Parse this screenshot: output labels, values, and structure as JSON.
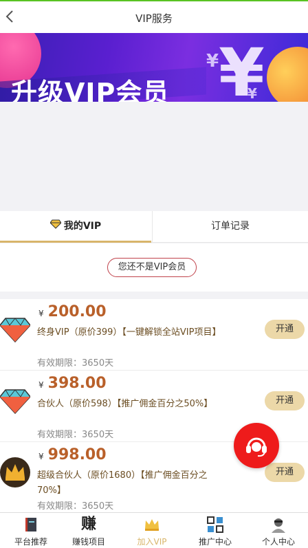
{
  "header": {
    "title": "VIP服务"
  },
  "banner": {
    "text": "升级VIP会员"
  },
  "tabs": [
    {
      "label": "我的VIP",
      "active": true
    },
    {
      "label": "订单记录",
      "active": false
    }
  ],
  "status": {
    "text": "您还不是VIP会员"
  },
  "plans": [
    {
      "currency": "¥",
      "price": "200.00",
      "desc": "终身VIP（原价399）【一键解锁全站VIP项目】",
      "validity": "有效期限：3650天",
      "button": "开通",
      "icon": "diamond-icon"
    },
    {
      "currency": "¥",
      "price": "398.00",
      "desc": "合伙人（原价598）【推广佣金百分之50%】",
      "validity": "有效期限：3650天",
      "button": "开通",
      "icon": "diamond-icon"
    },
    {
      "currency": "¥",
      "price": "998.00",
      "desc": "超级合伙人（原价1680）【推广佣金百分之70%】",
      "validity": "有效期限：3650天",
      "button": "开通",
      "icon": "crown-icon"
    }
  ],
  "nav": [
    {
      "label": "平台推荐",
      "icon": "book-icon",
      "active": false
    },
    {
      "label": "赚钱项目",
      "icon": "zhuan-character-icon",
      "active": false
    },
    {
      "label": "加入VIP",
      "icon": "crown-icon",
      "active": true
    },
    {
      "label": "推广中心",
      "icon": "qrcode-icon",
      "active": false
    },
    {
      "label": "个人中心",
      "icon": "user-icon",
      "active": false
    }
  ],
  "colors": {
    "accent": "#d8b56a",
    "price": "#b9602a",
    "topbar": "#58c322",
    "fab": "#ee1b1b"
  }
}
